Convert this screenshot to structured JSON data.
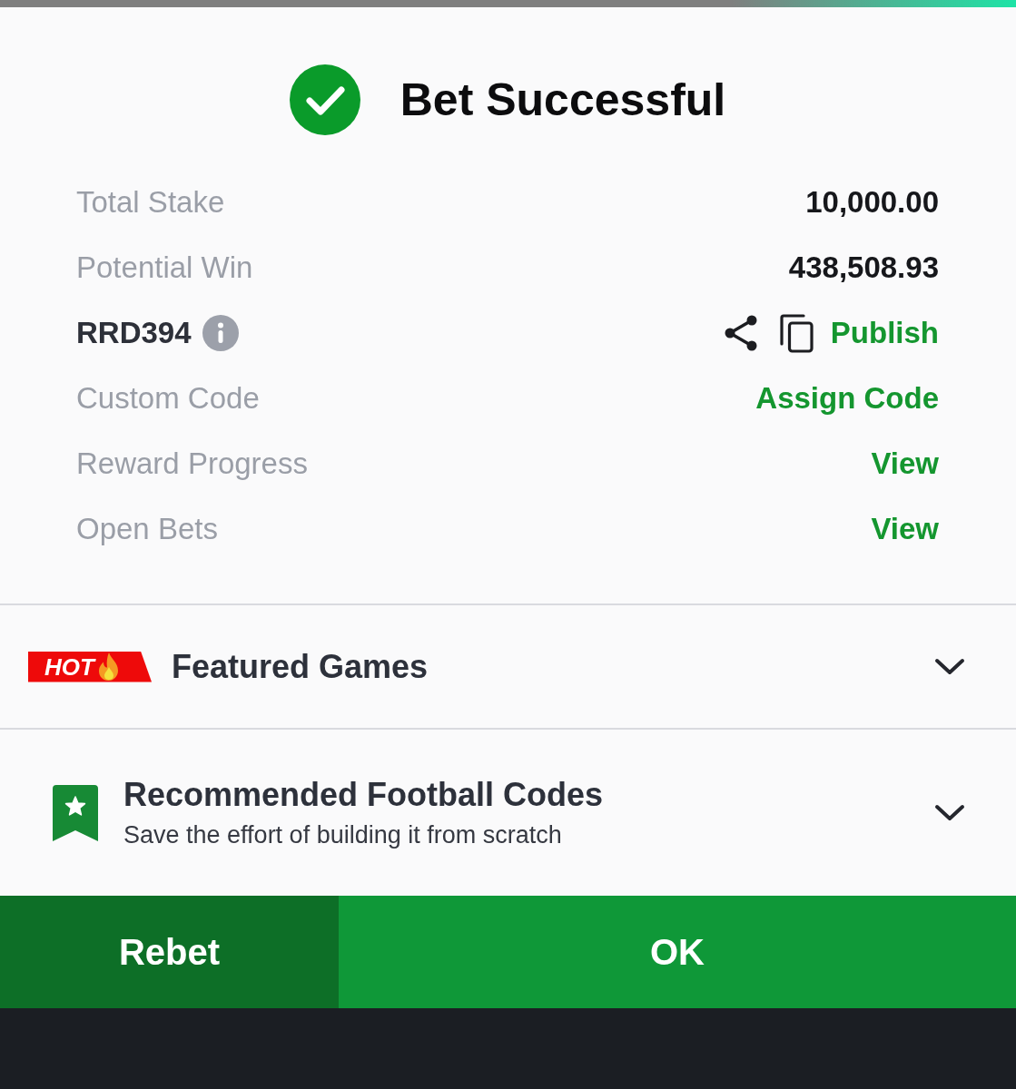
{
  "header": {
    "title": "Bet Successful"
  },
  "details": [
    {
      "kind": "amount",
      "label": "Total Stake",
      "value": "10,000.00"
    },
    {
      "kind": "amount",
      "label": "Potential Win",
      "value": "438,508.93"
    },
    {
      "kind": "code",
      "label": "RRD394",
      "action": "Publish"
    },
    {
      "kind": "link",
      "label": "Custom Code",
      "action": "Assign Code"
    },
    {
      "kind": "link",
      "label": "Reward Progress",
      "action": "View"
    },
    {
      "kind": "link",
      "label": "Open Bets",
      "action": "View"
    }
  ],
  "sections": [
    {
      "kind": "featured",
      "badge": "HOT",
      "title": "Featured Games",
      "expanded": false
    },
    {
      "kind": "recommended",
      "title": "Recommended Football Codes",
      "subtitle": "Save the effort of building it from scratch",
      "expanded": false
    }
  ],
  "buttons": [
    {
      "kind": "secondary",
      "label": "Rebet"
    },
    {
      "kind": "primary",
      "label": "OK"
    }
  ]
}
